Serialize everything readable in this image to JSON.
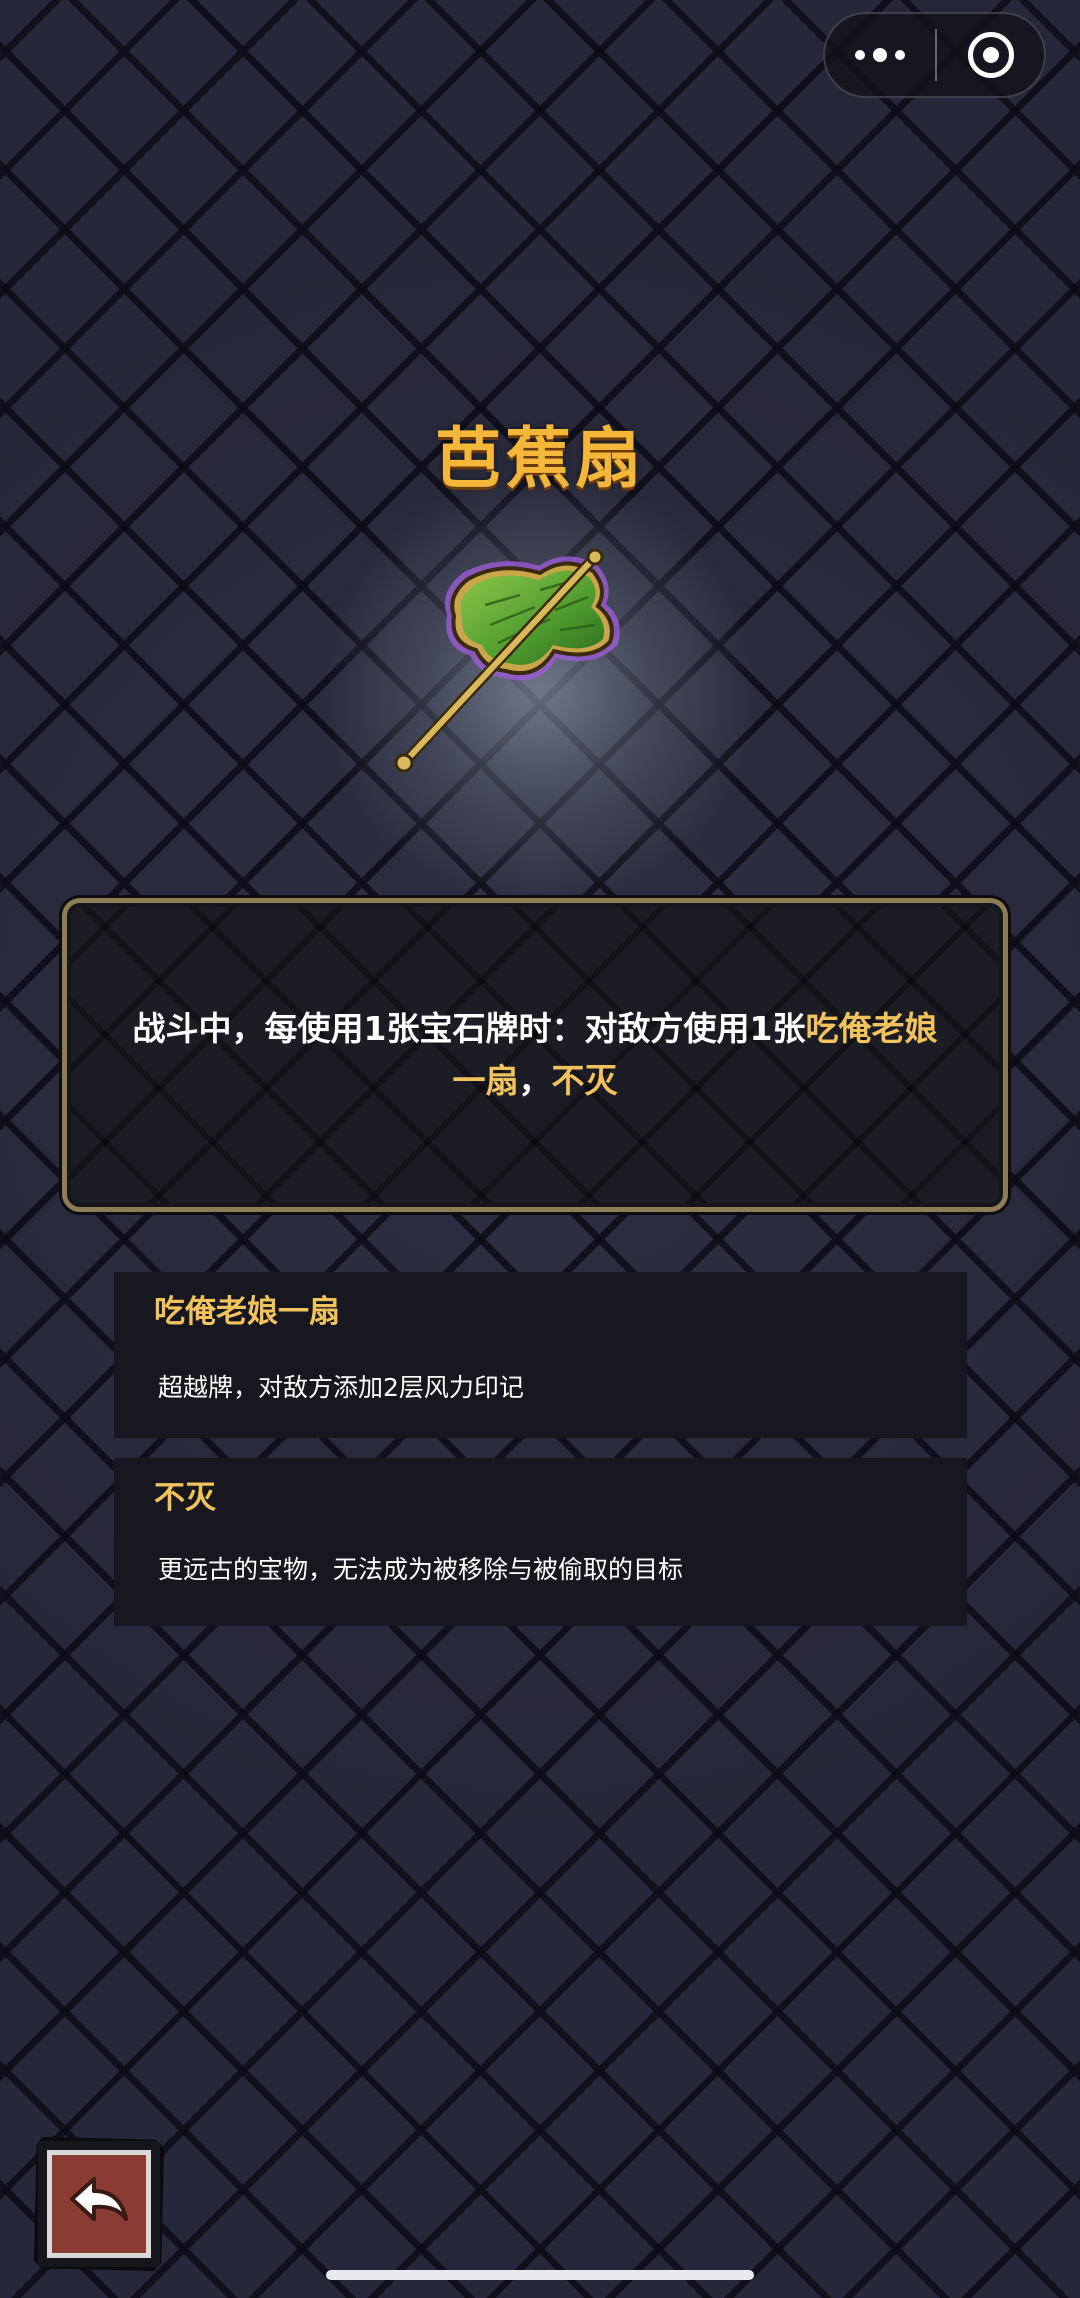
{
  "capsule": {
    "more_icon": "more-dots-icon",
    "close_icon": "target-circle-icon"
  },
  "item": {
    "name": "芭蕉扇",
    "image_icon": "banana-leaf-fan-icon"
  },
  "description": {
    "part1": "战斗中，每使用1张宝石牌时：对敌方使用1张",
    "highlight1": "吃俺老娘一扇",
    "sep": "，",
    "highlight2": "不灭"
  },
  "terms": [
    {
      "name": "吃俺老娘一扇",
      "desc": "超越牌，对敌方添加2层风力印记"
    },
    {
      "name": "不灭",
      "desc": "更远古的宝物，无法成为被移除与被偷取的目标"
    }
  ],
  "back_button": {
    "icon": "return-arrow-icon"
  },
  "colors": {
    "title": "#f4b73a",
    "highlight": "#f2c35d",
    "panel_border": "#8e7c55",
    "back_button": "#8a3b34"
  }
}
